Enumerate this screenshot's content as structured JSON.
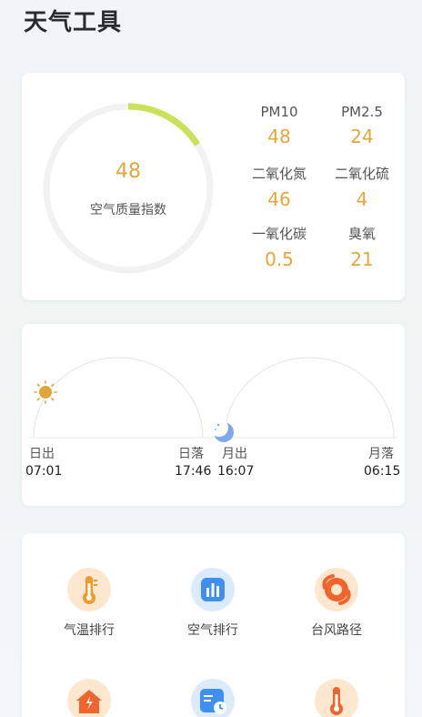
{
  "page": {
    "title": "天气工具"
  },
  "air_quality": {
    "index_value": "48",
    "index_label": "空气质量指数",
    "index_fraction": 0.16,
    "ring_color": "#c9e25a",
    "value_color": "#e2a83c",
    "pollutants": [
      {
        "name": "PM10",
        "value": "48"
      },
      {
        "name": "PM2.5",
        "value": "24"
      },
      {
        "name": "二氧化氮",
        "value": "46"
      },
      {
        "name": "二氧化硫",
        "value": "4"
      },
      {
        "name": "一氧化碳",
        "value": "0.5"
      },
      {
        "name": "臭氧",
        "value": "21"
      }
    ]
  },
  "sun_moon": {
    "sunrise_label": "日出",
    "sunrise_time": "07:01",
    "sunset_label": "日落",
    "sunset_time": "17:46",
    "moonrise_label": "月出",
    "moonrise_time": "16:07",
    "moonset_label": "月落",
    "moonset_time": "06:15",
    "sun_icon": "sun-icon",
    "moon_icon": "moon-icon"
  },
  "tools": [
    {
      "label": "气温排行",
      "icon": "thermometer-icon"
    },
    {
      "label": "空气排行",
      "icon": "bar-chart-icon"
    },
    {
      "label": "台风路径",
      "icon": "typhoon-icon"
    },
    {
      "label": "",
      "icon": "house-alert-icon"
    },
    {
      "label": "",
      "icon": "calendar-clock-icon"
    },
    {
      "label": "",
      "icon": "thermometer-icon"
    }
  ]
}
